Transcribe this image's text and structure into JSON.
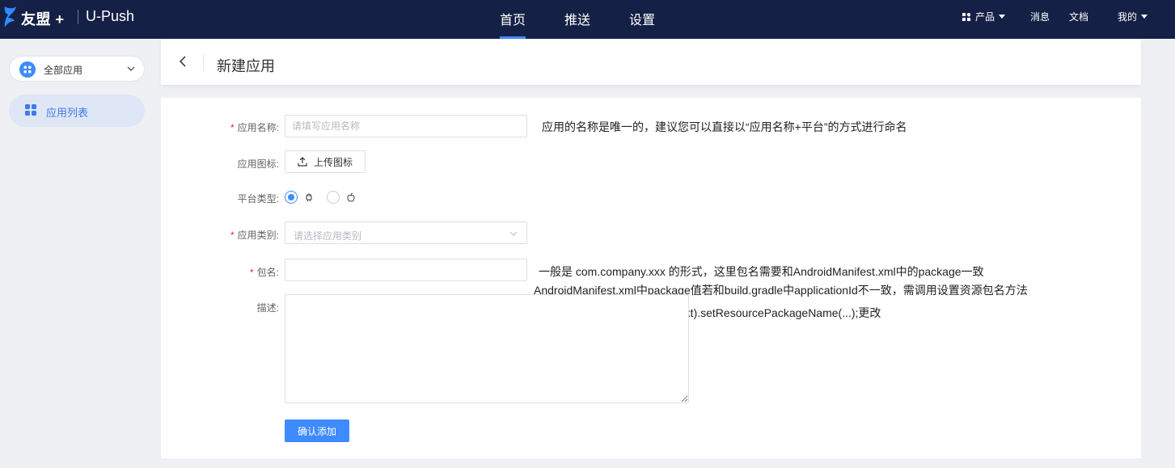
{
  "topbar": {
    "brand": "友盟 +",
    "product": "U-Push",
    "tabs": [
      {
        "label": "首页",
        "active": true
      },
      {
        "label": "推送",
        "active": false
      },
      {
        "label": "设置",
        "active": false
      }
    ],
    "right": {
      "products": "产品",
      "messages": "消息",
      "docs": "文档",
      "me": "我的"
    }
  },
  "sidebar": {
    "app_select": "全部应用",
    "items": [
      {
        "label": "应用列表",
        "icon": "grid-icon",
        "active": true
      }
    ]
  },
  "header": {
    "title": "新建应用"
  },
  "form": {
    "app_name": {
      "label": "应用名称:",
      "required": true,
      "placeholder": "请填写应用名称",
      "value": "",
      "hint": "应用的名称是唯一的，建议您可以直接以“应用名称+平台”的方式进行命名"
    },
    "app_icon": {
      "label": "应用图标:",
      "upload_label": "上传图标"
    },
    "platform": {
      "label": "平台类型:",
      "options": [
        {
          "icon": "android-icon",
          "checked": true
        },
        {
          "icon": "apple-icon",
          "checked": false
        }
      ]
    },
    "category": {
      "label": "应用类别:",
      "required": true,
      "placeholder": "请选择应用类别"
    },
    "package": {
      "label": "包名:",
      "required": true,
      "value": "",
      "hint_lines": [
        "一般是 com.company.xxx 的形式，这里包名需要和AndroidManifest.xml中的package一致",
        "AndroidManifest.xml中package值若和build.gradle中applicationId不一致，需调用设置资源包名方法",
        "PushAgent.getInstance(context).setResourcePackageName(...);更改"
      ]
    },
    "description": {
      "label": "描述:",
      "value": ""
    },
    "submit_label": "确认添加"
  },
  "colors": {
    "topbar_bg": "#152046",
    "accent": "#3d8bff",
    "required": "#e0283a",
    "sidebar_active_bg": "#dfe6f5"
  }
}
